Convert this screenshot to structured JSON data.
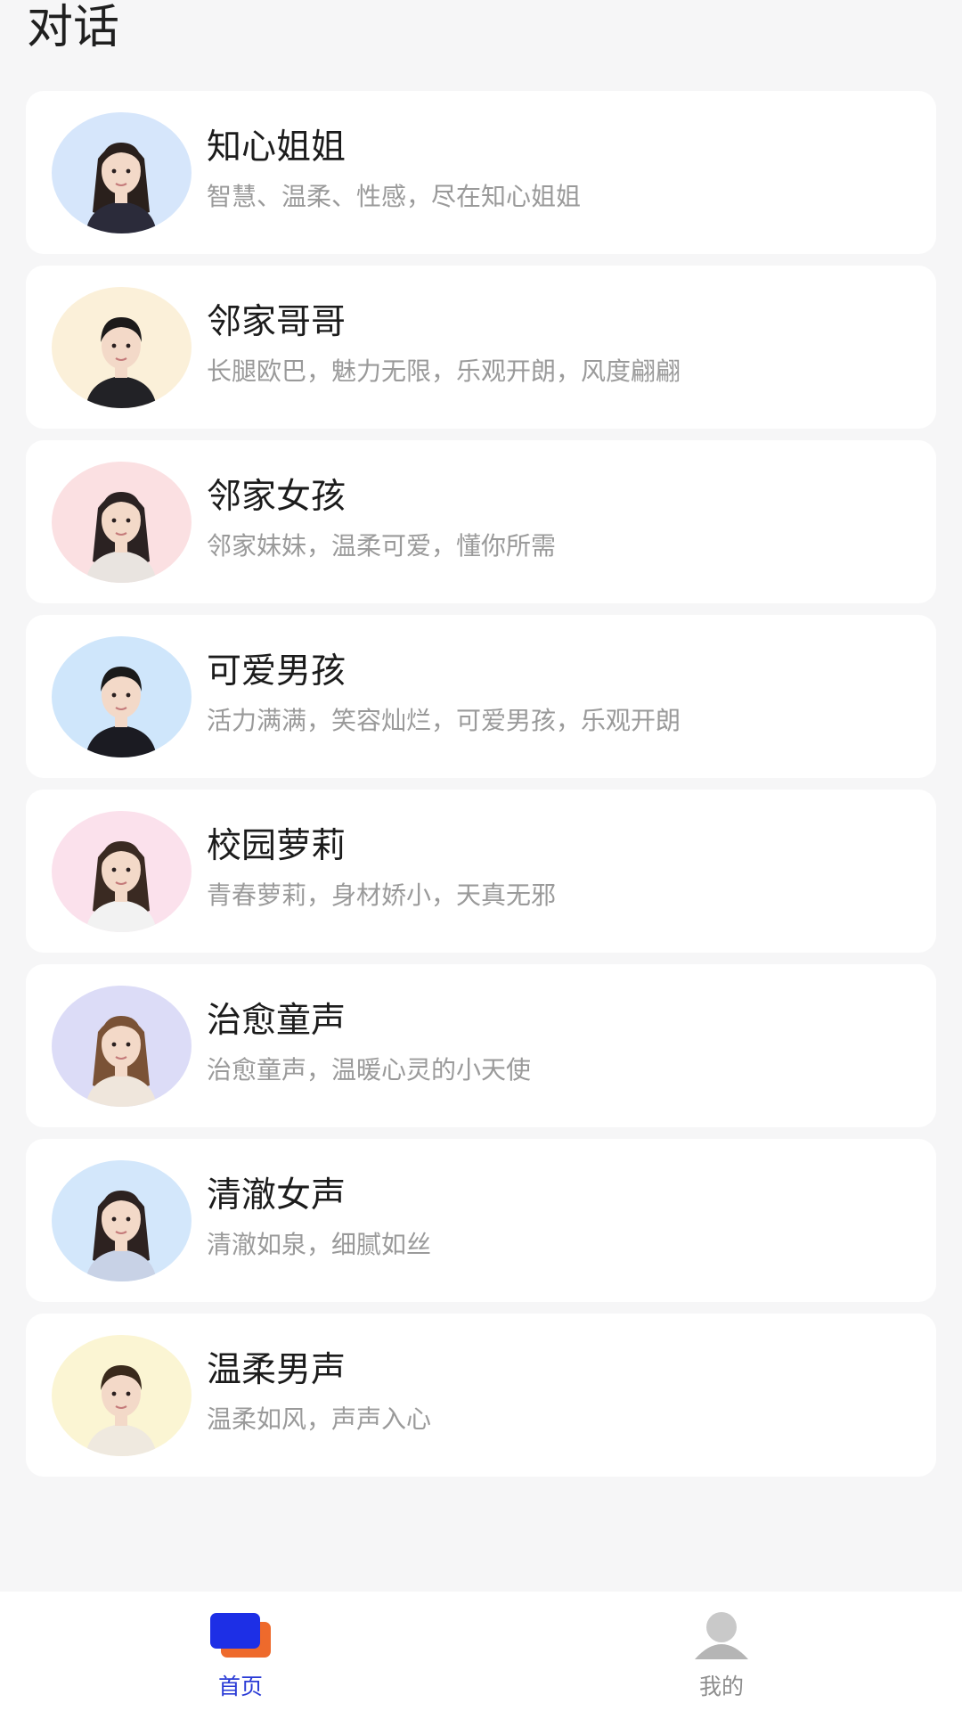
{
  "header": {
    "title": "对话"
  },
  "characters": [
    {
      "name": "知心姐姐",
      "desc": "智慧、温柔、性感，尽在知心姐姐",
      "avatar_icon": "woman-short-hair-avatar",
      "bg": "#d6e6fb",
      "hair": "#2a201c"
    },
    {
      "name": "邻家哥哥",
      "desc": "长腿欧巴，魅力无限，乐观开朗，风度翩翩",
      "avatar_icon": "young-man-avatar",
      "bg": "#fbf0d9",
      "hair": "#1c1a1a"
    },
    {
      "name": "邻家女孩",
      "desc": "邻家妹妹，温柔可爱，懂你所需",
      "avatar_icon": "girl-long-hair-avatar",
      "bg": "#fbe0e2",
      "hair": "#2b2222"
    },
    {
      "name": "可爱男孩",
      "desc": "活力满满，笑容灿烂，可爱男孩，乐观开朗",
      "avatar_icon": "boy-avatar",
      "bg": "#cfe6fb",
      "hair": "#1a1a1a"
    },
    {
      "name": "校园萝莉",
      "desc": "青春萝莉，身材娇小，天真无邪",
      "avatar_icon": "school-girl-avatar",
      "bg": "#fbe1ec",
      "hair": "#3a2a22"
    },
    {
      "name": "治愈童声",
      "desc": "治愈童声，温暖心灵的小天使",
      "avatar_icon": "little-girl-avatar",
      "bg": "#dcdcf7",
      "hair": "#7a5236"
    },
    {
      "name": "清澈女声",
      "desc": "清澈如泉，细腻如丝",
      "avatar_icon": "young-woman-avatar",
      "bg": "#d3e7fb",
      "hair": "#2d2220"
    },
    {
      "name": "温柔男声",
      "desc": "温柔如风，声声入心",
      "avatar_icon": "gentle-man-avatar",
      "bg": "#fbf5d3",
      "hair": "#3a2a1c"
    }
  ],
  "tabbar": {
    "home": {
      "label": "首页",
      "icon": "chat-bubbles-icon"
    },
    "mine": {
      "label": "我的",
      "icon": "user-profile-icon"
    }
  },
  "colors": {
    "accent": "#2a3bd6",
    "accent_secondary": "#ee6a2c",
    "muted": "#8d8d8d"
  }
}
